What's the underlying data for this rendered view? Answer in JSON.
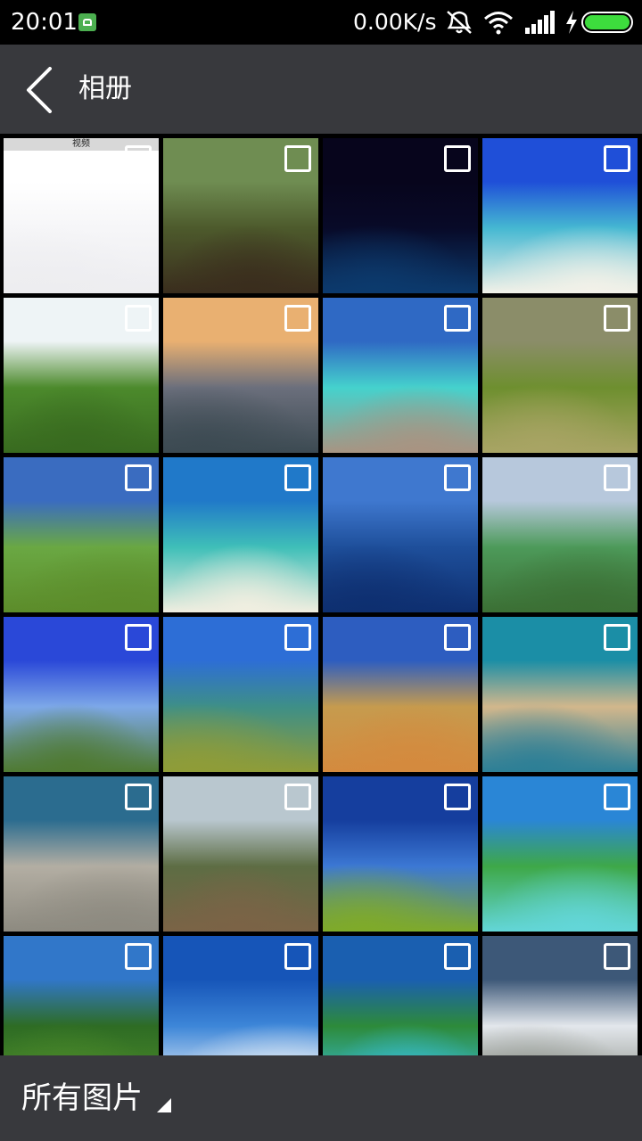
{
  "status_bar": {
    "time": "20:01",
    "net_speed": "0.00K/s",
    "icons": [
      "app-notification-icon",
      "mute-icon",
      "wifi-icon",
      "signal-icon",
      "charging-icon",
      "battery-icon"
    ],
    "battery_color": "#3ddc3d"
  },
  "header": {
    "back_icon": "chevron-left-icon",
    "title": "相册",
    "background": "#38393d"
  },
  "grid": {
    "columns": 4,
    "tiles": [
      {
        "kind": "video",
        "label": "视频",
        "colors": [
          "#ffffff",
          "#f6f6f8",
          "#ededf0"
        ],
        "selected": false
      },
      {
        "kind": "image",
        "colors": [
          "#6f8d52",
          "#4d5a2c",
          "#3a2d1d"
        ],
        "selected": false
      },
      {
        "kind": "image",
        "colors": [
          "#07051c",
          "#080a28",
          "#0c3a6d"
        ],
        "selected": false
      },
      {
        "kind": "image",
        "colors": [
          "#1f4fd8",
          "#45b8d2",
          "#f2f1e8"
        ],
        "selected": false
      },
      {
        "kind": "image",
        "colors": [
          "#eef4f6",
          "#4c8a2c",
          "#386a1f"
        ],
        "selected": false
      },
      {
        "kind": "image",
        "colors": [
          "#e9b071",
          "#6b6f7c",
          "#3c4a52"
        ],
        "selected": false
      },
      {
        "kind": "image",
        "colors": [
          "#2f69c4",
          "#45d2cd",
          "#a89482"
        ],
        "selected": false
      },
      {
        "kind": "image",
        "colors": [
          "#8b8d69",
          "#6e8f2f",
          "#a8a464"
        ],
        "selected": false
      },
      {
        "kind": "image",
        "colors": [
          "#3a6cc0",
          "#6aa843",
          "#5c8c2a"
        ],
        "selected": false
      },
      {
        "kind": "image",
        "colors": [
          "#2079c9",
          "#3fbfb8",
          "#f0eee0"
        ],
        "selected": false
      },
      {
        "kind": "image",
        "colors": [
          "#3f78cf",
          "#1e4f9b",
          "#0e2f70"
        ],
        "selected": false
      },
      {
        "kind": "image",
        "colors": [
          "#b7c8dc",
          "#4d9a5a",
          "#3b6f34"
        ],
        "selected": false
      },
      {
        "kind": "image",
        "colors": [
          "#2a48d8",
          "#7da8e8",
          "#4f7a32"
        ],
        "selected": false
      },
      {
        "kind": "image",
        "colors": [
          "#2d6ed6",
          "#3e8f87",
          "#8f9c38"
        ],
        "selected": false
      },
      {
        "kind": "image",
        "colors": [
          "#2d5dc0",
          "#c69b4e",
          "#d48a3e"
        ],
        "selected": false
      },
      {
        "kind": "image",
        "colors": [
          "#1b8ea6",
          "#d2b78c",
          "#2d7f96"
        ],
        "selected": false
      },
      {
        "kind": "image",
        "colors": [
          "#2b6c8f",
          "#b3aea3",
          "#8d8a80"
        ],
        "selected": false
      },
      {
        "kind": "image",
        "colors": [
          "#b9c7cf",
          "#5d6d44",
          "#7b6346"
        ],
        "selected": false
      },
      {
        "kind": "image",
        "colors": [
          "#153e9e",
          "#3c78d4",
          "#7faa2a"
        ],
        "selected": false
      },
      {
        "kind": "image",
        "colors": [
          "#2a86d6",
          "#3ea848",
          "#63d6d8"
        ],
        "selected": false
      },
      {
        "kind": "image",
        "colors": [
          "#3177c9",
          "#2e6c24",
          "#4d8b2a"
        ],
        "selected": false
      },
      {
        "kind": "image",
        "colors": [
          "#1655b8",
          "#3d86d8",
          "#f3f6f8"
        ],
        "selected": false
      },
      {
        "kind": "image",
        "colors": [
          "#1a5fb0",
          "#2d8a3a",
          "#39c2e0"
        ],
        "selected": false
      },
      {
        "kind": "image",
        "colors": [
          "#3d5878",
          "#e3e7ec",
          "#8a8f86"
        ],
        "selected": false
      }
    ]
  },
  "bottom_bar": {
    "album_label": "所有图片",
    "dropdown_icon": "triangle-dropdown-icon"
  }
}
